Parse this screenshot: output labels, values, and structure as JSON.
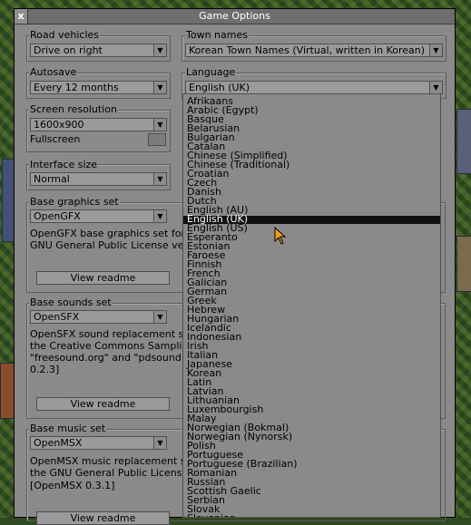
{
  "window": {
    "title": "Game Options",
    "close_label": "x"
  },
  "road_vehicles": {
    "label": "Road vehicles",
    "value": "Drive on right"
  },
  "town_names": {
    "label": "Town names",
    "value": "Korean Town Names (Virtual, written in Korean)"
  },
  "autosave": {
    "label": "Autosave",
    "value": "Every 12 months"
  },
  "language": {
    "label": "Language",
    "value": "English (UK)"
  },
  "screen_resolution": {
    "label": "Screen resolution",
    "value": "1600x900",
    "fullscreen_label": "Fullscreen"
  },
  "interface_size": {
    "label": "Interface size",
    "value": "Normal"
  },
  "base_graphics": {
    "label": "Base graphics set",
    "value": "OpenGFX",
    "description": [
      "OpenGFX base graphics set for",
      "GNU General Public License ve"
    ],
    "readme_label": "View readme"
  },
  "base_sounds": {
    "label": "Base sounds set",
    "value": "OpenSFX",
    "description": [
      "OpenSFX sound replacement se",
      "the Creative Commons Samplin",
      "\"freesound.org\" and \"pdsound.",
      "0.2.3]"
    ],
    "readme_label": "View readme"
  },
  "base_music": {
    "label": "Base music set",
    "value": "OpenMSX",
    "description": [
      "OpenMSX music replacement s",
      "the GNU General Public Licens",
      "[OpenMSX 0.3.1]"
    ],
    "readme_label": "View readme"
  },
  "language_list": {
    "selected": "English (UK)",
    "items": [
      "Afrikaans",
      "Arabic (Egypt)",
      "Basque",
      "Belarusian",
      "Bulgarian",
      "Catalan",
      "Chinese (Simplified)",
      "Chinese (Traditional)",
      "Croatian",
      "Czech",
      "Danish",
      "Dutch",
      "English (AU)",
      "English (UK)",
      "English (US)",
      "Esperanto",
      "Estonian",
      "Faroese",
      "Finnish",
      "French",
      "Galician",
      "German",
      "Greek",
      "Hebrew",
      "Hungarian",
      "Icelandic",
      "Indonesian",
      "Irish",
      "Italian",
      "Japanese",
      "Korean",
      "Latin",
      "Latvian",
      "Lithuanian",
      "Luxembourgish",
      "Malay",
      "Norwegian (Bokmal)",
      "Norwegian (Nynorsk)",
      "Polish",
      "Portuguese",
      "Portuguese (Brazilian)",
      "Romanian",
      "Russian",
      "Scottish Gaelic",
      "Serbian",
      "Slovak",
      "Slovenian"
    ]
  },
  "icons": {
    "dropdown": "triangle-down",
    "cursor": "arrow-pointer"
  },
  "colors": {
    "window_bg": "#8a8a8a",
    "selection_bg": "#111111",
    "cursor": "#f0a020"
  }
}
